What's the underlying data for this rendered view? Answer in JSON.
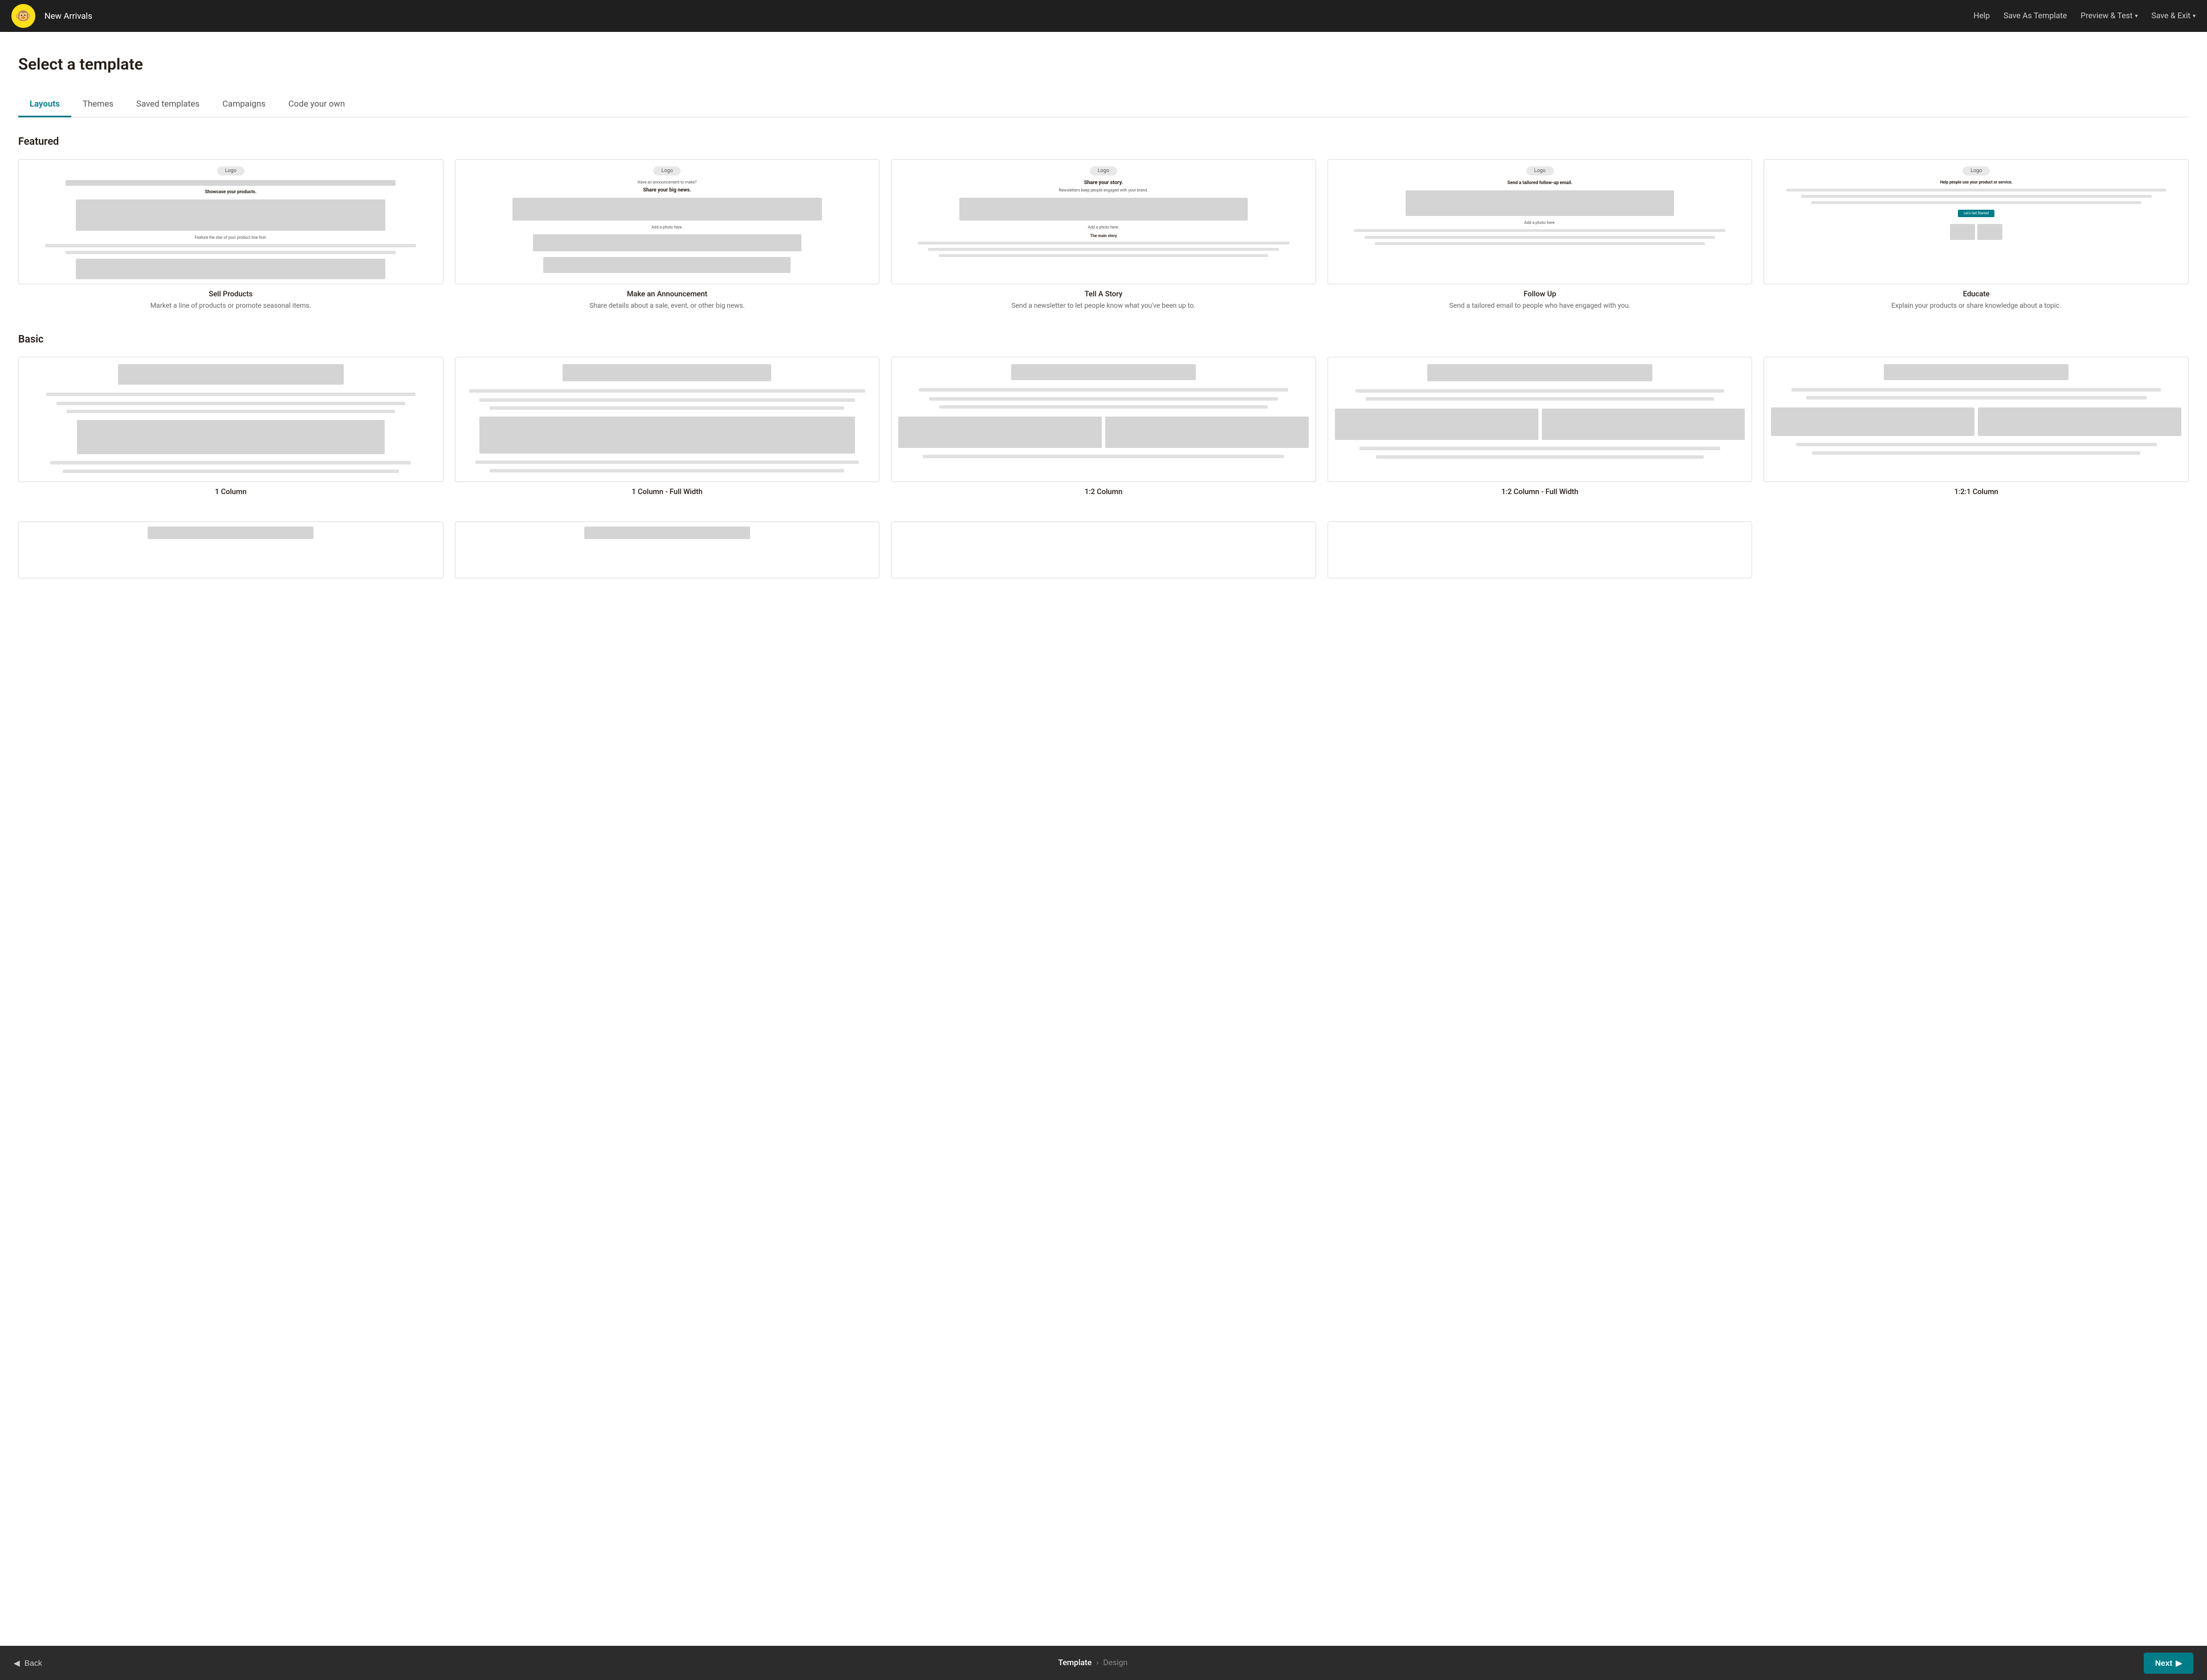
{
  "nav": {
    "logo_emoji": "🐵",
    "title": "New Arrivals",
    "help": "Help",
    "save_as_template": "Save As Template",
    "preview_test": "Preview & Test",
    "save_exit": "Save & Exit"
  },
  "page": {
    "title": "Select a template"
  },
  "tabs": [
    {
      "id": "layouts",
      "label": "Layouts",
      "active": true
    },
    {
      "id": "themes",
      "label": "Themes",
      "active": false
    },
    {
      "id": "saved",
      "label": "Saved templates",
      "active": false
    },
    {
      "id": "campaigns",
      "label": "Campaigns",
      "active": false
    },
    {
      "id": "code",
      "label": "Code your own",
      "active": false
    }
  ],
  "featured": {
    "section_title": "Featured",
    "cards": [
      {
        "label": "Sell Products",
        "desc": "Market a line of products or promote seasonal items."
      },
      {
        "label": "Make an Announcement",
        "desc": "Share details about a sale, event, or other big news."
      },
      {
        "label": "Tell A Story",
        "desc": "Send a newsletter to let people know what you've been up to."
      },
      {
        "label": "Follow Up",
        "desc": "Send a tailored email to people who have engaged with you."
      },
      {
        "label": "Educate",
        "desc": "Explain your products or share knowledge about a topic."
      }
    ]
  },
  "basic": {
    "section_title": "Basic",
    "cards": [
      {
        "label": "1 Column"
      },
      {
        "label": "1 Column - Full Width"
      },
      {
        "label": "1:2 Column"
      },
      {
        "label": "1:2 Column - Full Width"
      },
      {
        "label": "1:2:1 Column"
      }
    ]
  },
  "bottom_bar": {
    "back": "Back",
    "breadcrumb_current": "Template",
    "breadcrumb_sep": "›",
    "breadcrumb_next": "Design",
    "next": "Next"
  }
}
